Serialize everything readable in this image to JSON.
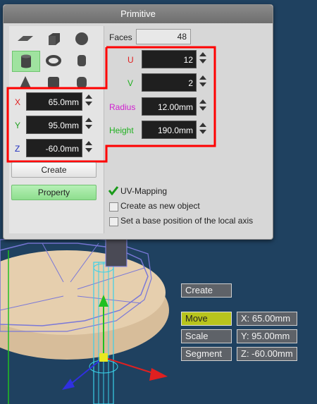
{
  "dialog": {
    "title": "Primitive",
    "faces_label": "Faces",
    "faces_value": "48",
    "shapes": [
      {
        "name": "plane-icon"
      },
      {
        "name": "cube-icon"
      },
      {
        "name": "sphere-icon"
      },
      {
        "name": "cylinder-icon",
        "selected": true
      },
      {
        "name": "torus-icon"
      },
      {
        "name": "capsule-icon"
      },
      {
        "name": "cone-icon"
      },
      {
        "name": "rounded-cube-icon"
      },
      {
        "name": "rounded-cylinder-icon"
      }
    ],
    "position": {
      "x_label": "X",
      "x_value": "65.0mm",
      "y_label": "Y",
      "y_value": "95.0mm",
      "z_label": "Z",
      "z_value": "-60.0mm"
    },
    "params": {
      "u_label": "U",
      "u_value": "12",
      "v_label": "V",
      "v_value": "2",
      "radius_label": "Radius",
      "radius_value": "12.00mm",
      "height_label": "Height",
      "height_value": "190.0mm"
    },
    "create_label": "Create",
    "property_label": "Property",
    "uv_mapping_label": "UV-Mapping",
    "create_new_object_label": "Create as new object",
    "base_position_label": "Set a base position of the local axis",
    "colors": {
      "x": "#e02020",
      "y": "#20a020",
      "z": "#2030c0",
      "u": "#e02020",
      "v": "#20b020",
      "radius": "#d020d0",
      "height": "#20b020",
      "highlight": "#ff0000"
    }
  },
  "viewport_panel": {
    "create_label": "Create",
    "move_label": "Move",
    "scale_label": "Scale",
    "segment_label": "Segment",
    "x_readout": "X: 65.00mm",
    "y_readout": "Y: 95.00mm",
    "z_readout": "Z: -60.00mm"
  }
}
